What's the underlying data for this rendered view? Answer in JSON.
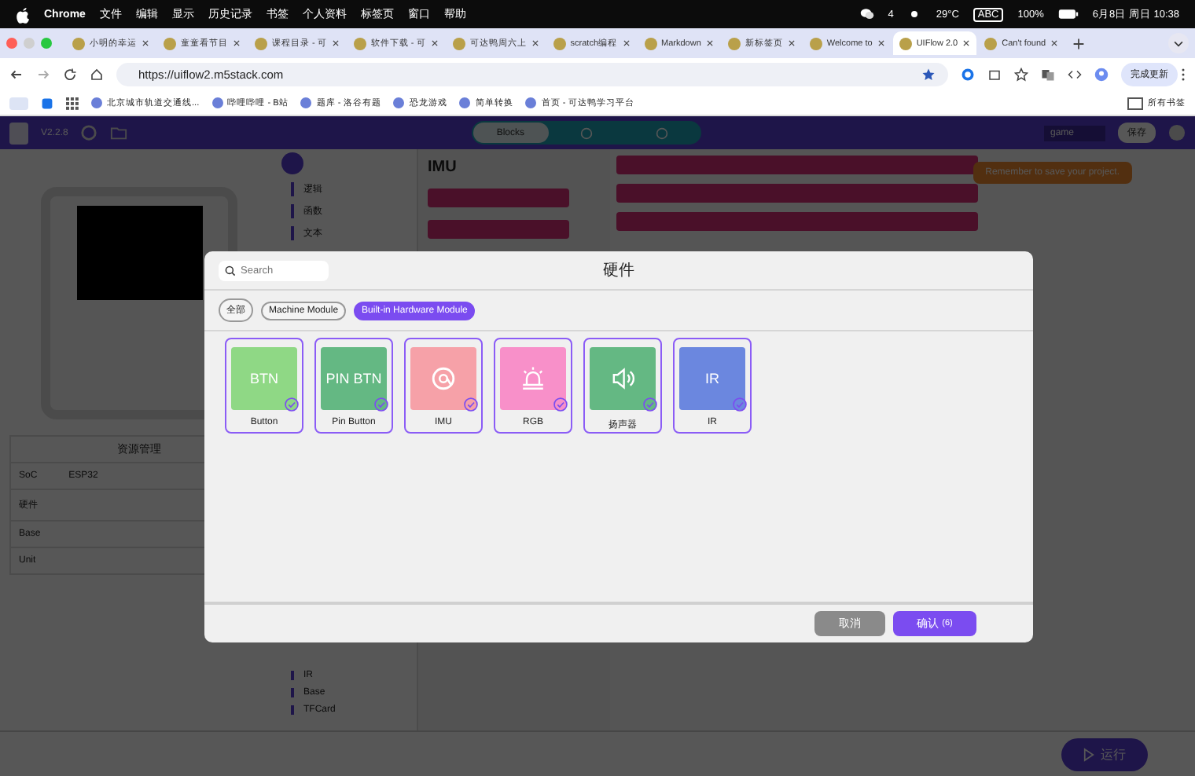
{
  "menu_bar": {
    "app": "Chrome",
    "items": [
      "文件",
      "编辑",
      "显示",
      "历史记录",
      "书签",
      "个人资料",
      "标签页",
      "窗口",
      "帮助"
    ],
    "status": {
      "messages": "4",
      "weather": "29°C",
      "input": "ABC",
      "battery": "100%",
      "datetime": "6月8日 周日 10:38"
    }
  },
  "tabs": [
    {
      "label": "小明的幸运",
      "selected": false
    },
    {
      "label": "童童看节目",
      "selected": false
    },
    {
      "label": "课程目录 - 可",
      "selected": false
    },
    {
      "label": "软件下载 - 可",
      "selected": false
    },
    {
      "label": "可达鸭周六上",
      "selected": false
    },
    {
      "label": "scratch编程",
      "selected": false
    },
    {
      "label": "Markdown",
      "selected": false
    },
    {
      "label": "新标签页",
      "selected": false
    },
    {
      "label": "Welcome to",
      "selected": false
    },
    {
      "label": "UIFlow 2.0",
      "selected": true
    },
    {
      "label": "Can't found",
      "selected": false
    }
  ],
  "address_bar": {
    "url": "https://uiflow2.m5stack.com",
    "update_button": "完成更新"
  },
  "bookmarks": {
    "items": [
      "北京城市轨道交通线...",
      "哔哩哔哩 - B站",
      "题库 - 洛谷有题",
      "恐龙游戏",
      "简单转换",
      "首页 - 可达鸭学习平台"
    ],
    "all_bookmarks": "所有书签"
  },
  "app": {
    "version": "V2.2.8",
    "mode_tabs": [
      {
        "label": "Blocks",
        "selected": true
      },
      {
        "selected": false
      },
      {
        "selected": false
      }
    ],
    "project_name": "game",
    "save_button": "保存",
    "toast": "Remember to save your project.",
    "categories": [
      "逻辑",
      "函数",
      "文本"
    ],
    "lower_categories": [
      "IR",
      "Base",
      "TFCard"
    ],
    "workspace_title": "IMU",
    "resources": {
      "title": "资源管理",
      "rows": [
        {
          "label": "SoC",
          "value": "ESP32"
        },
        {
          "label": "硬件"
        },
        {
          "label": "Base"
        },
        {
          "label": "Unit"
        }
      ]
    },
    "run_button": "运行"
  },
  "dialog": {
    "title": "硬件",
    "search": {
      "placeholder": "Search"
    },
    "filters": [
      {
        "label": "全部",
        "selected": false
      },
      {
        "label": "Machine Module",
        "selected": false
      },
      {
        "label": "Built-in Hardware Module",
        "selected": true
      }
    ],
    "items": [
      {
        "label": "Button",
        "kind": "text",
        "icon_text": "BTN",
        "color": "#8fd885",
        "checked": true
      },
      {
        "label": "Pin Button",
        "kind": "text",
        "icon_text": "PIN BTN",
        "color": "#64b883",
        "checked": true
      },
      {
        "label": "IMU",
        "kind": "imu",
        "color": "#f6a1a8",
        "checked": true
      },
      {
        "label": "RGB",
        "kind": "light",
        "color": "#f890c9",
        "checked": true
      },
      {
        "label": "扬声器",
        "kind": "speaker",
        "color": "#64b883",
        "checked": true
      },
      {
        "label": "IR",
        "kind": "text",
        "icon_text": "IR",
        "color": "#6b87df",
        "checked": true
      }
    ],
    "cancel_button": "取消",
    "confirm_button": "确认",
    "confirm_count": "(6)"
  }
}
